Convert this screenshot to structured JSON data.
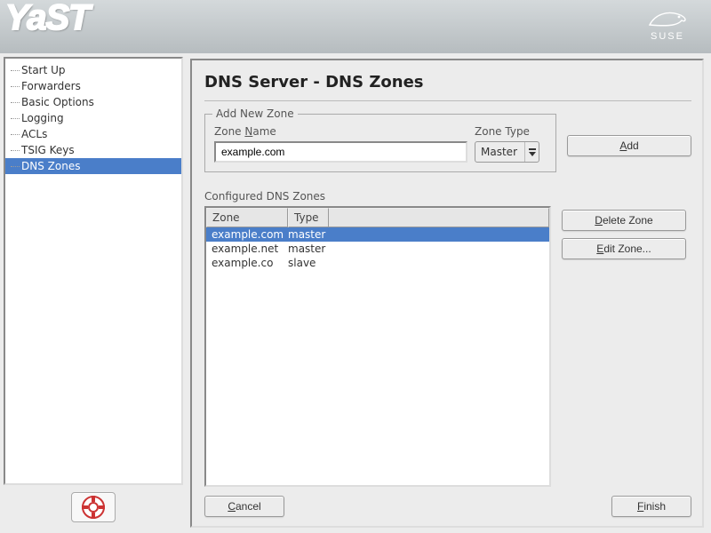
{
  "brand": {
    "product": "YaST",
    "distro": "SUSE"
  },
  "sidebar": {
    "items": [
      {
        "label": "Start Up"
      },
      {
        "label": "Forwarders"
      },
      {
        "label": "Basic Options"
      },
      {
        "label": "Logging"
      },
      {
        "label": "ACLs"
      },
      {
        "label": "TSIG Keys"
      },
      {
        "label": "DNS Zones"
      }
    ],
    "selected_index": 6
  },
  "page": {
    "title": "DNS Server - DNS Zones",
    "add_zone": {
      "group_label": "Add New Zone",
      "name_label": "Zone Name",
      "name_label_prefix": "Zone ",
      "name_label_accel": "N",
      "name_label_suffix": "ame",
      "name_value": "example.com",
      "type_label": "Zone Type",
      "type_value": "Master",
      "add_btn_accel": "A",
      "add_btn_suffix": "dd"
    },
    "zones": {
      "heading": "Configured DNS Zones",
      "columns": {
        "zone": "Zone",
        "type": "Type"
      },
      "rows": [
        {
          "zone": "example.com",
          "type": "master"
        },
        {
          "zone": "example.net",
          "type": "master"
        },
        {
          "zone": "example.co",
          "type": "slave"
        }
      ],
      "selected_index": 0,
      "delete_btn_prefix": "",
      "delete_btn_accel": "D",
      "delete_btn_suffix": "elete Zone",
      "edit_btn_prefix": "",
      "edit_btn_accel": "E",
      "edit_btn_suffix": "dit Zone..."
    },
    "buttons": {
      "cancel_accel": "C",
      "cancel_suffix": "ancel",
      "finish_accel": "F",
      "finish_suffix": "inish"
    }
  }
}
